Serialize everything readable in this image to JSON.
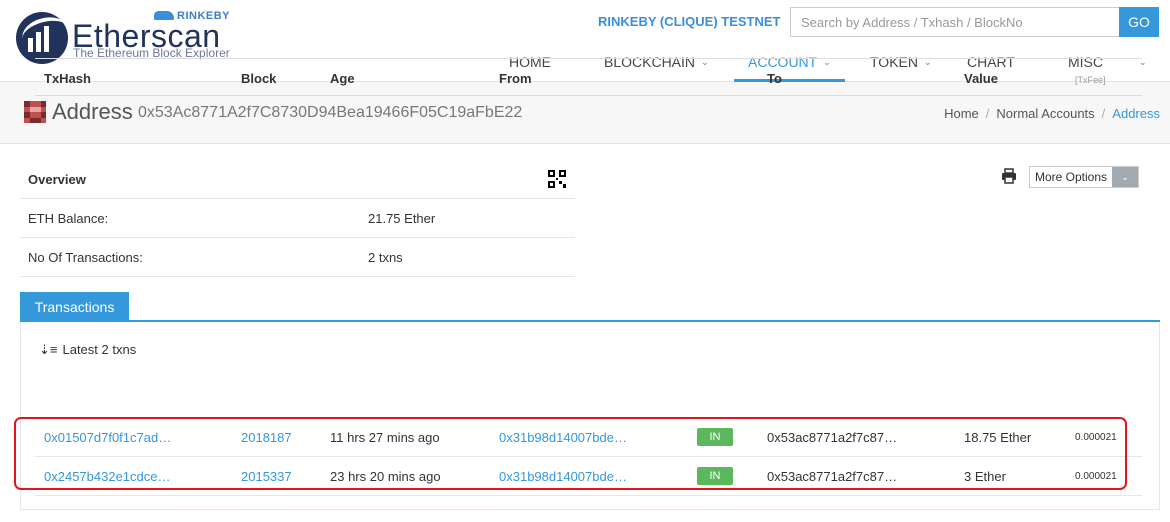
{
  "brand": {
    "name": "Etherscan",
    "tagline": "The Ethereum Block Explorer",
    "network_badge": "RINKEBY"
  },
  "header": {
    "network": "RINKEBY (CLIQUE) TESTNET",
    "search_placeholder": "Search by Address / Txhash / BlockNo",
    "go_label": "GO"
  },
  "nav": {
    "items": [
      {
        "label": "HOME"
      },
      {
        "label": "BLOCKCHAIN"
      },
      {
        "label": "ACCOUNT"
      },
      {
        "label": "TOKEN"
      },
      {
        "label": "CHART"
      },
      {
        "label": "MISC"
      }
    ],
    "active": "ACCOUNT",
    "chevron": "⌄"
  },
  "page": {
    "title": "Address",
    "address": "0x53Ac8771A2f7C8730D94Bea19466F05C19aFbE22",
    "breadcrumb": [
      "Home",
      "Normal Accounts",
      "Address"
    ],
    "breadcrumb_sep": "/"
  },
  "overview": {
    "title": "Overview",
    "rows": [
      {
        "label": "ETH Balance:",
        "value": "21.75 Ether"
      },
      {
        "label": "No Of Transactions:",
        "value": "2 txns"
      }
    ]
  },
  "options": {
    "more_label": "More Options"
  },
  "transactions": {
    "tab_label": "Transactions",
    "summary": "Latest 2 txns",
    "columns": [
      "TxHash",
      "Block",
      "Age",
      "From",
      "To",
      "Value",
      "[TxFee]"
    ],
    "rows": [
      {
        "hash": "0x01507d7f0f1c7ad…",
        "block": "2018187",
        "age": "11 hrs 27 mins ago",
        "from": "0x31b98d14007bde…",
        "direction": "IN",
        "to": "0x53ac8771a2f7c87…",
        "value": "18.75 Ether",
        "fee": "0.000021"
      },
      {
        "hash": "0x2457b432e1cdce…",
        "block": "2015337",
        "age": "23 hrs 20 mins ago",
        "from": "0x31b98d14007bde…",
        "direction": "IN",
        "to": "0x53ac8771a2f7c87…",
        "value": "3 Ether",
        "fee": "0.000021"
      }
    ]
  },
  "colors": {
    "accent": "#3498db",
    "in_badge": "#5cb85c",
    "highlight": "#e3141b"
  }
}
